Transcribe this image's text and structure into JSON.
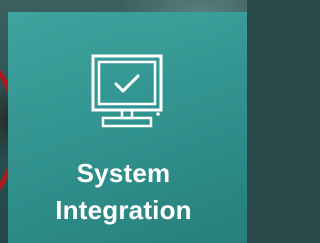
{
  "tile": {
    "title_line1": "System",
    "title_line2": "Integration",
    "icon": "monitor-checkmark-icon"
  },
  "colors": {
    "tile": "#33a39f",
    "ring": "#b01818",
    "text": "#ffffff"
  }
}
